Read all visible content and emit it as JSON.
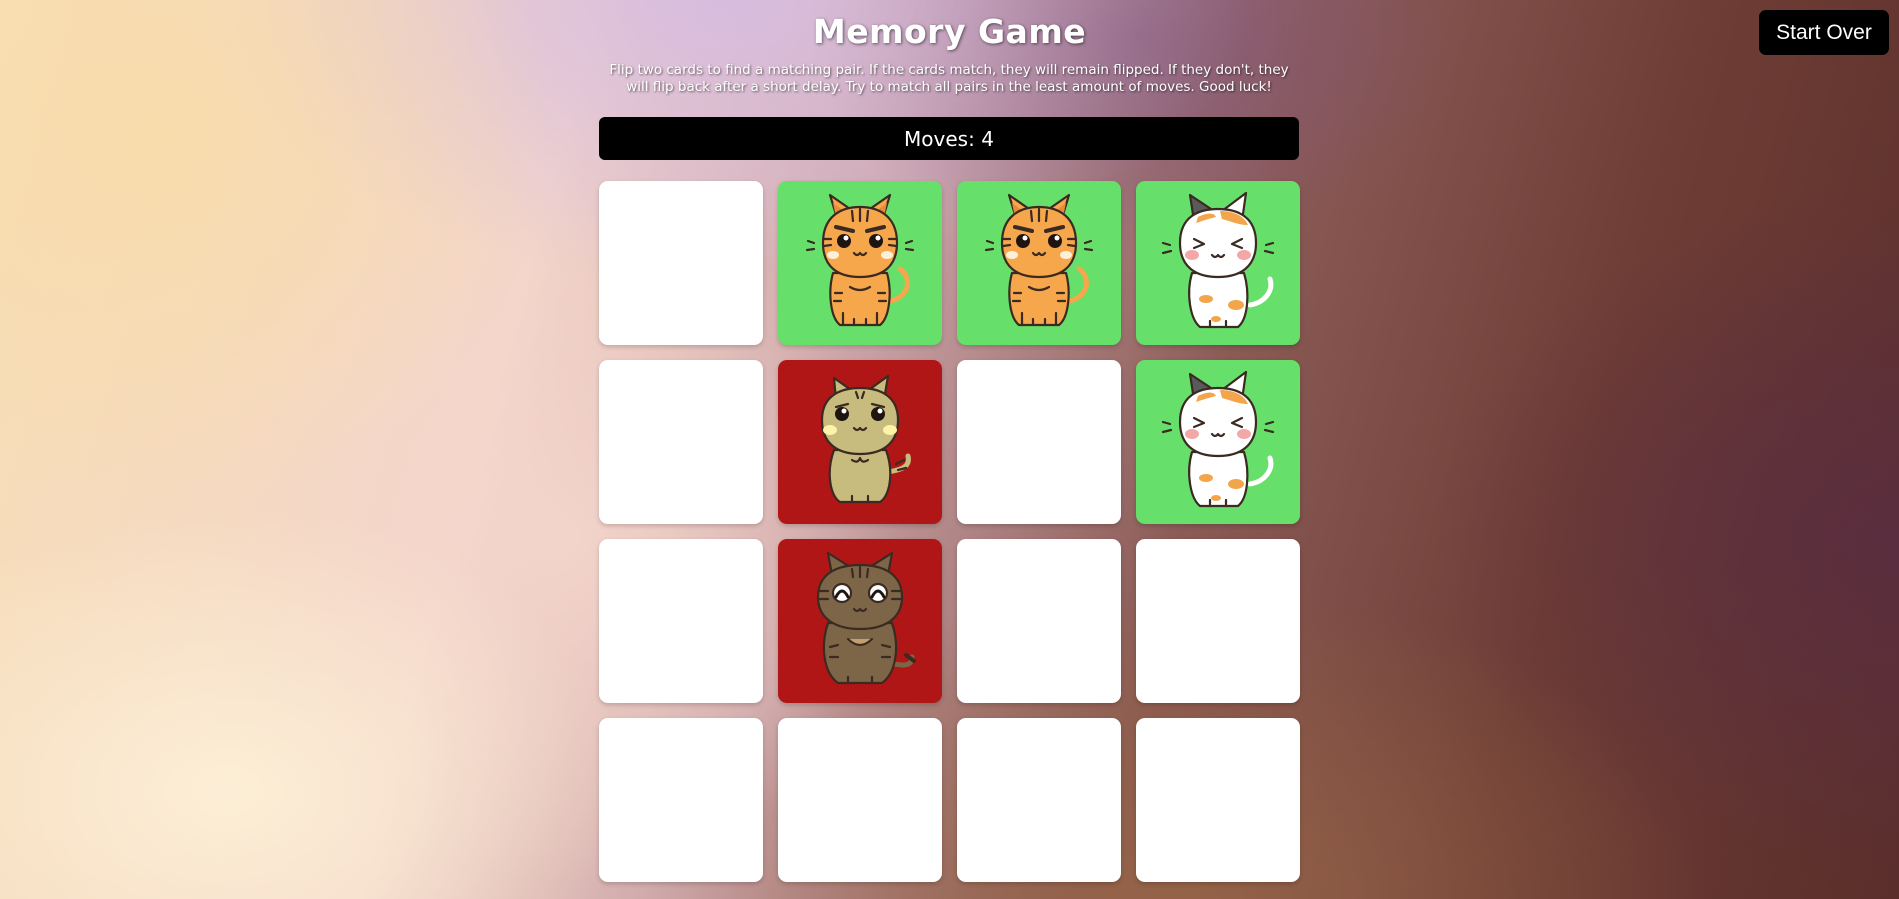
{
  "game": {
    "title": "Memory Game",
    "description": "Flip two cards to find a matching pair. If the cards match, they will remain flipped. If they don't, they will flip back after a short delay. Try to match all pairs in the least amount of moves. Good luck!",
    "moves_label": "Moves:",
    "moves": "4",
    "start_over_label": "Start Over"
  },
  "colors": {
    "matched_card": "#66e06a",
    "mismatched_card": "#b11616",
    "hidden_card": "#ffffff",
    "button_bg": "#000000"
  },
  "board": {
    "rows": 4,
    "columns": 4,
    "cards": [
      {
        "state": "hidden",
        "icon": ""
      },
      {
        "state": "matched",
        "icon": "orange-tabby-cat-icon"
      },
      {
        "state": "matched",
        "icon": "orange-tabby-cat-icon"
      },
      {
        "state": "matched",
        "icon": "calico-cat-icon"
      },
      {
        "state": "hidden",
        "icon": ""
      },
      {
        "state": "mismatched",
        "icon": "beige-cat-icon"
      },
      {
        "state": "hidden",
        "icon": ""
      },
      {
        "state": "matched",
        "icon": "calico-cat-icon"
      },
      {
        "state": "hidden",
        "icon": ""
      },
      {
        "state": "mismatched",
        "icon": "brown-tabby-cat-icon"
      },
      {
        "state": "hidden",
        "icon": ""
      },
      {
        "state": "hidden",
        "icon": ""
      },
      {
        "state": "hidden",
        "icon": ""
      },
      {
        "state": "hidden",
        "icon": ""
      },
      {
        "state": "hidden",
        "icon": ""
      },
      {
        "state": "hidden",
        "icon": ""
      }
    ]
  }
}
